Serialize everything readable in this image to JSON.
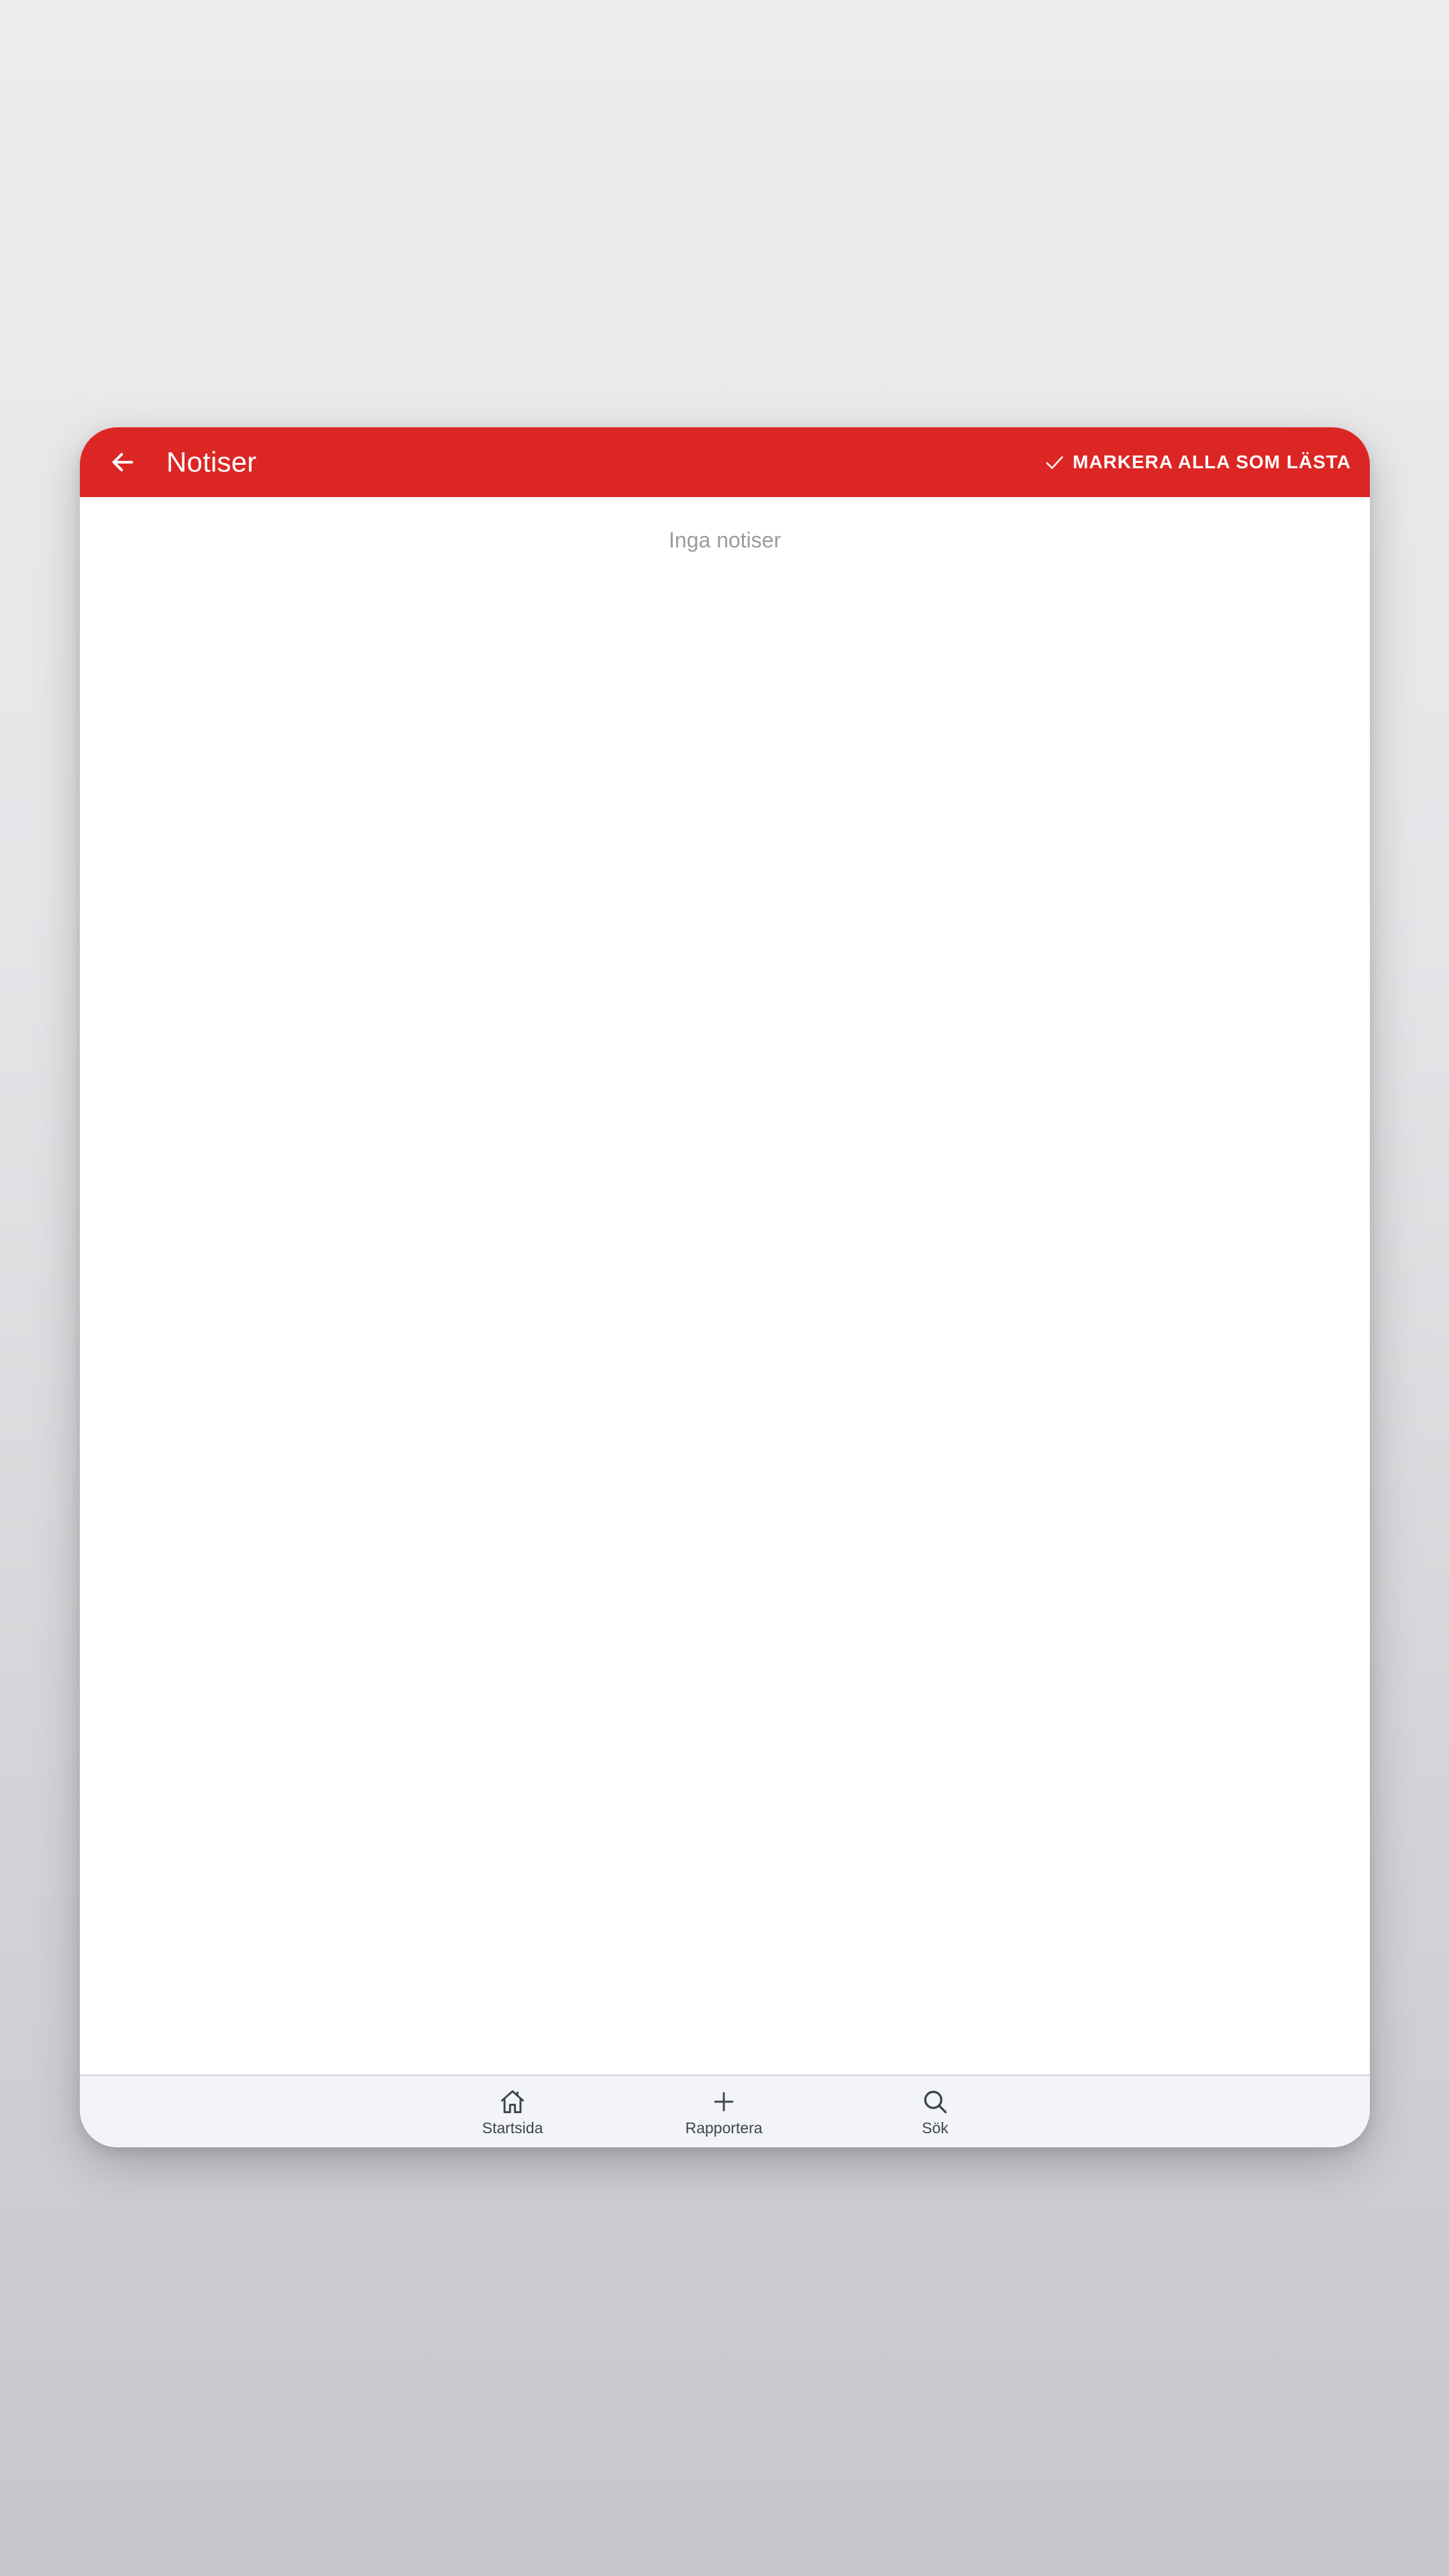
{
  "app_bar": {
    "title": "Notiser",
    "back_icon": "arrow-left-icon",
    "mark_all_icon": "checkmark-icon",
    "mark_all_label": "MARKERA ALLA SOM LÄSTA",
    "background_color": "#dc2624"
  },
  "content": {
    "empty_message": "Inga notiser"
  },
  "bottom_nav": {
    "items": [
      {
        "label": "Startsida",
        "icon": "home-icon"
      },
      {
        "label": "Rapportera",
        "icon": "plus-icon"
      },
      {
        "label": "Sök",
        "icon": "search-icon"
      }
    ]
  }
}
